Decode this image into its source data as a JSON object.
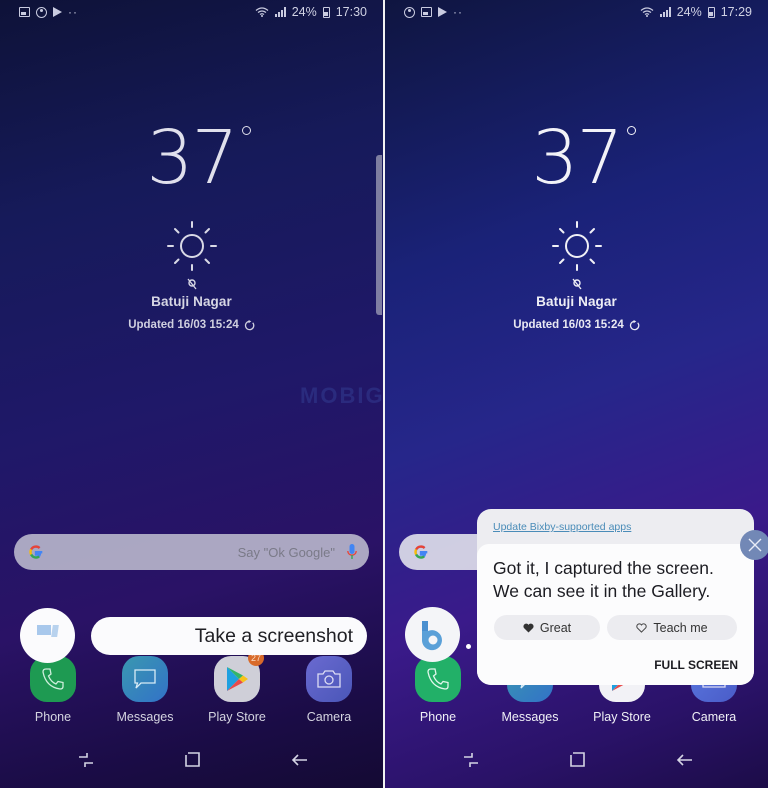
{
  "screens": [
    {
      "id": "left",
      "status_bar": {
        "left_icons": [
          "image-icon",
          "account-icon",
          "play-icon",
          "more-dots-icon"
        ],
        "battery": "24%",
        "time": "17:30"
      },
      "weather": {
        "temperature": "37",
        "condition": "sunny",
        "location": "Batuji Nagar",
        "updated": "Updated 16/03 15:24"
      },
      "search_bar": {
        "logo": "G",
        "placeholder": "Say \"Ok Google\""
      },
      "assistant": {
        "command": "Take a screenshot"
      },
      "dock": [
        {
          "label": "Phone",
          "icon": "phone-icon"
        },
        {
          "label": "Messages",
          "icon": "messages-icon"
        },
        {
          "label": "Play Store",
          "icon": "play-store-icon",
          "badge": "27"
        },
        {
          "label": "Camera",
          "icon": "camera-icon"
        }
      ]
    },
    {
      "id": "right",
      "status_bar": {
        "left_icons": [
          "account-icon",
          "image-icon",
          "play-icon",
          "more-dots-icon"
        ],
        "battery": "24%",
        "time": "17:29"
      },
      "weather": {
        "temperature": "37",
        "condition": "sunny",
        "location": "Batuji Nagar",
        "updated": "Updated 16/03 15:24"
      },
      "search_bar": {
        "logo": "G"
      },
      "bixby": {
        "update_link": "Update Bixby-supported apps",
        "message": "Got it, I captured the screen. We can see it in the Gallery.",
        "great_label": "Great",
        "teach_label": "Teach me",
        "full_screen_label": "FULL SCREEN"
      },
      "dock": [
        {
          "label": "Phone",
          "icon": "phone-icon"
        },
        {
          "label": "Messages",
          "icon": "messages-icon"
        },
        {
          "label": "Play Store",
          "icon": "play-store-icon"
        },
        {
          "label": "Camera",
          "icon": "camera-icon"
        }
      ]
    }
  ],
  "watermark": "MOBIGYAAN",
  "colors": {
    "bixby_link": "#4a8cb8",
    "close_button": "#7288b6",
    "badge": "#d86a2a",
    "phone_green": "#1e9a52"
  }
}
